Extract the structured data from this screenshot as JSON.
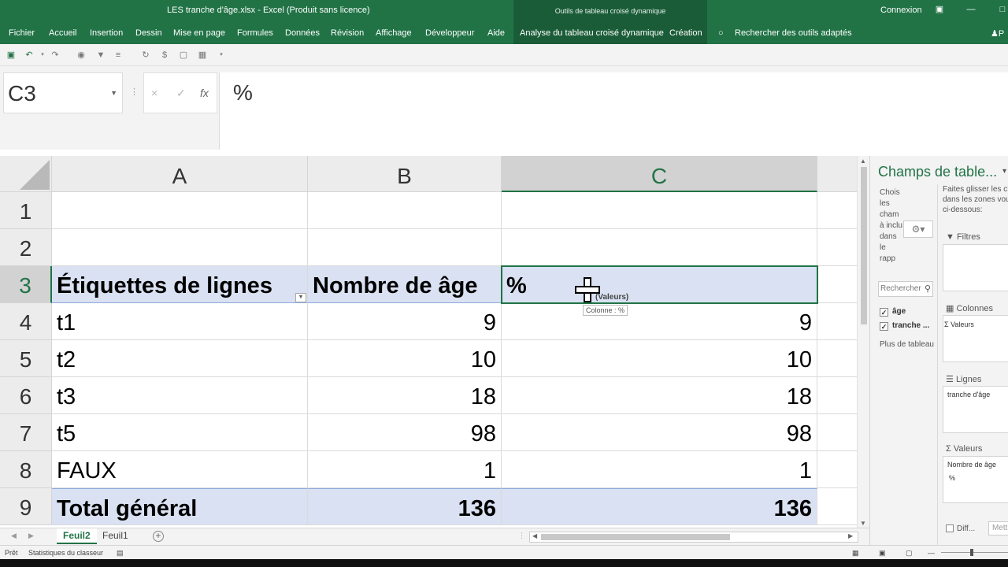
{
  "titlebar": {
    "title": "LES tranche d'âge.xlsx  -  Excel (Produit sans licence)",
    "context_tools": "Outils de tableau croisé dynamique",
    "connexion": "Connexion",
    "restore_icon": "ribbon-display-icon",
    "minimize_icon": "minimize-icon",
    "maximize_icon": "maximize-icon"
  },
  "ribbon": {
    "tabs": [
      {
        "label": "Fichier"
      },
      {
        "label": "Accueil"
      },
      {
        "label": "Insertion"
      },
      {
        "label": "Dessin"
      },
      {
        "label": "Mise en page"
      },
      {
        "label": "Formules"
      },
      {
        "label": "Données"
      },
      {
        "label": "Révision"
      },
      {
        "label": "Affichage"
      },
      {
        "label": "Développeur"
      },
      {
        "label": "Aide"
      },
      {
        "label": "Analyse du tableau croisé dynamique"
      },
      {
        "label": "Création"
      }
    ],
    "search": "Rechercher des outils adaptés",
    "share_partial": "P"
  },
  "formula_bar": {
    "name_box": "C3",
    "cancel": "×",
    "enter": "✓",
    "fx": "fx",
    "content": "%"
  },
  "columns": [
    {
      "label": "A"
    },
    {
      "label": "B"
    },
    {
      "label": "C"
    }
  ],
  "rows": [
    {
      "num": "1",
      "a": "",
      "b": "",
      "c": ""
    },
    {
      "num": "2",
      "a": "",
      "b": "",
      "c": ""
    },
    {
      "num": "3",
      "a": "Étiquettes de lignes",
      "b": "Nombre de âge",
      "c": "%"
    },
    {
      "num": "4",
      "a": "t1",
      "b": "9",
      "c": "9"
    },
    {
      "num": "5",
      "a": "t2",
      "b": "10",
      "c": "10"
    },
    {
      "num": "6",
      "a": "t3",
      "b": "18",
      "c": "18"
    },
    {
      "num": "7",
      "a": "t5",
      "b": "98",
      "c": "98"
    },
    {
      "num": "8",
      "a": "FAUX",
      "b": "1",
      "c": "1"
    },
    {
      "num": "9",
      "a": "Total général",
      "b": "136",
      "c": "136"
    }
  ],
  "drag": {
    "label": "(Valeurs)",
    "tooltip": "Colonne : %"
  },
  "sheets": [
    {
      "label": "Feuil2",
      "active": true
    },
    {
      "label": "Feuil1",
      "active": false
    }
  ],
  "status": {
    "ready": "Prêt",
    "stats": "Statistiques du classeur"
  },
  "pivot_panel": {
    "title": "Champs de table...",
    "choose_text": "Chois les cham à inclu dans le rapp",
    "drag_text_1": "Faites glisser les ch",
    "drag_text_2": "dans les zones vou",
    "drag_text_3": "ci-dessous:",
    "search_placeholder": "Rechercher",
    "fields": [
      {
        "label": "âge",
        "checked": true
      },
      {
        "label": "tranche ...",
        "checked": true
      }
    ],
    "more_tables": "Plus de tableau",
    "zones": {
      "filters": "Filtres",
      "columns": "Colonnes",
      "columns_item": "Valeurs",
      "rows": "Lignes",
      "rows_item": "tranche d'âge",
      "values": "Valeurs",
      "values_item_1": "Nombre de âge",
      "values_item_2": "%"
    },
    "defer": "Diff...",
    "update": "Mett"
  },
  "colors": {
    "accent": "#217346",
    "pivot_header": "#d9e1f2"
  }
}
